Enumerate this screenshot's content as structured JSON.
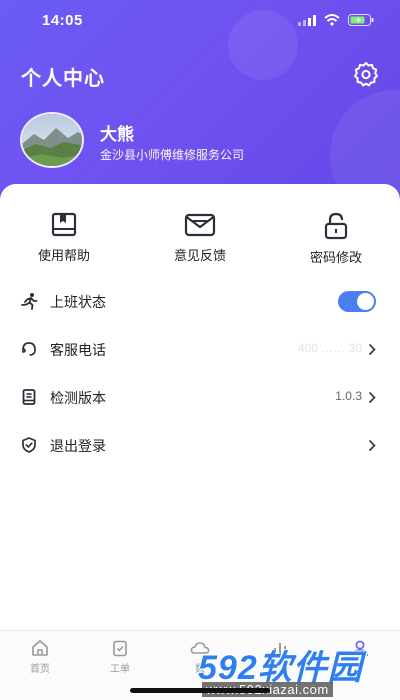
{
  "status_bar": {
    "time": "14:05"
  },
  "header": {
    "title": "个人中心",
    "user_name": "大熊",
    "user_company": "金沙县小师傅维修服务公司"
  },
  "quick_actions": [
    {
      "label": "使用帮助",
      "icon": "book-icon"
    },
    {
      "label": "意见反馈",
      "icon": "mail-icon"
    },
    {
      "label": "密码修改",
      "icon": "lock-icon"
    }
  ],
  "menu": [
    {
      "label": "上班状态",
      "icon": "running-icon",
      "toggle_on": true
    },
    {
      "label": "客服电话",
      "icon": "headset-icon",
      "value": "400 …… 30"
    },
    {
      "label": "检测版本",
      "icon": "document-icon",
      "value": "1.0.3"
    },
    {
      "label": "退出登录",
      "icon": "shield-icon"
    }
  ],
  "tabbar": [
    {
      "label": "首页",
      "icon": "home-icon"
    },
    {
      "label": "工单",
      "icon": "clipboard-icon"
    },
    {
      "label": "数",
      "icon": "cloud-icon"
    },
    {
      "label": "",
      "icon": "chart-icon"
    },
    {
      "label": "",
      "icon": "user-icon"
    }
  ],
  "watermark": {
    "brand": "592软件园",
    "url": "www.592xiazai.com"
  },
  "colors": {
    "accent": "#6a5cf5",
    "toggle": "#4a7ff3",
    "watermark": "#2f7ff0"
  }
}
